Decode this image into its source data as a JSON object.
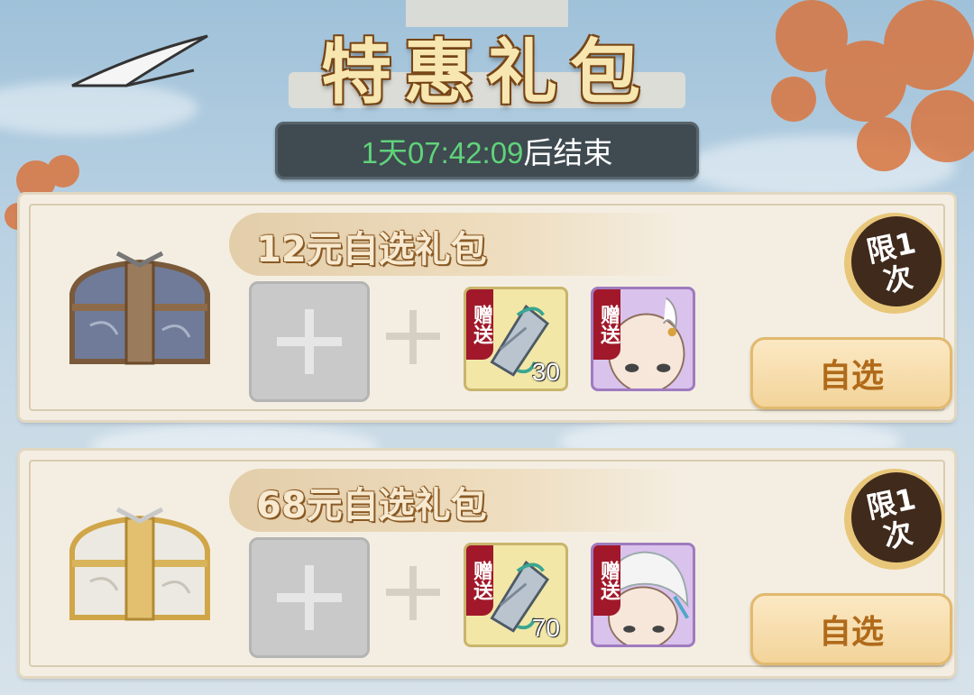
{
  "header": {
    "title": "特惠礼包",
    "countdown": "1天07:42:09",
    "countdown_suffix": "后结束"
  },
  "packs": [
    {
      "name": "12元自选礼包",
      "limit_line1": "限1",
      "limit_line2": "次",
      "gift_tag": "赠送",
      "gift_items": [
        {
          "icon": "bracer-icon",
          "qty": "30",
          "rarity": "gold"
        },
        {
          "icon": "character-portrait-bald-icon",
          "qty": "",
          "rarity": "purple"
        }
      ],
      "button_label": "自选",
      "chest": "blue-chest-icon"
    },
    {
      "name": "68元自选礼包",
      "limit_line1": "限1",
      "limit_line2": "次",
      "gift_tag": "赠送",
      "gift_items": [
        {
          "icon": "bracer-icon",
          "qty": "70",
          "rarity": "gold"
        },
        {
          "icon": "character-portrait-white-hair-icon",
          "qty": "",
          "rarity": "purple"
        }
      ],
      "button_label": "自选",
      "chest": "gold-chest-icon"
    }
  ],
  "colors": {
    "countdown": "#5fd37a",
    "button_text": "#b06a1a",
    "gift_tag": "#a0182a"
  }
}
